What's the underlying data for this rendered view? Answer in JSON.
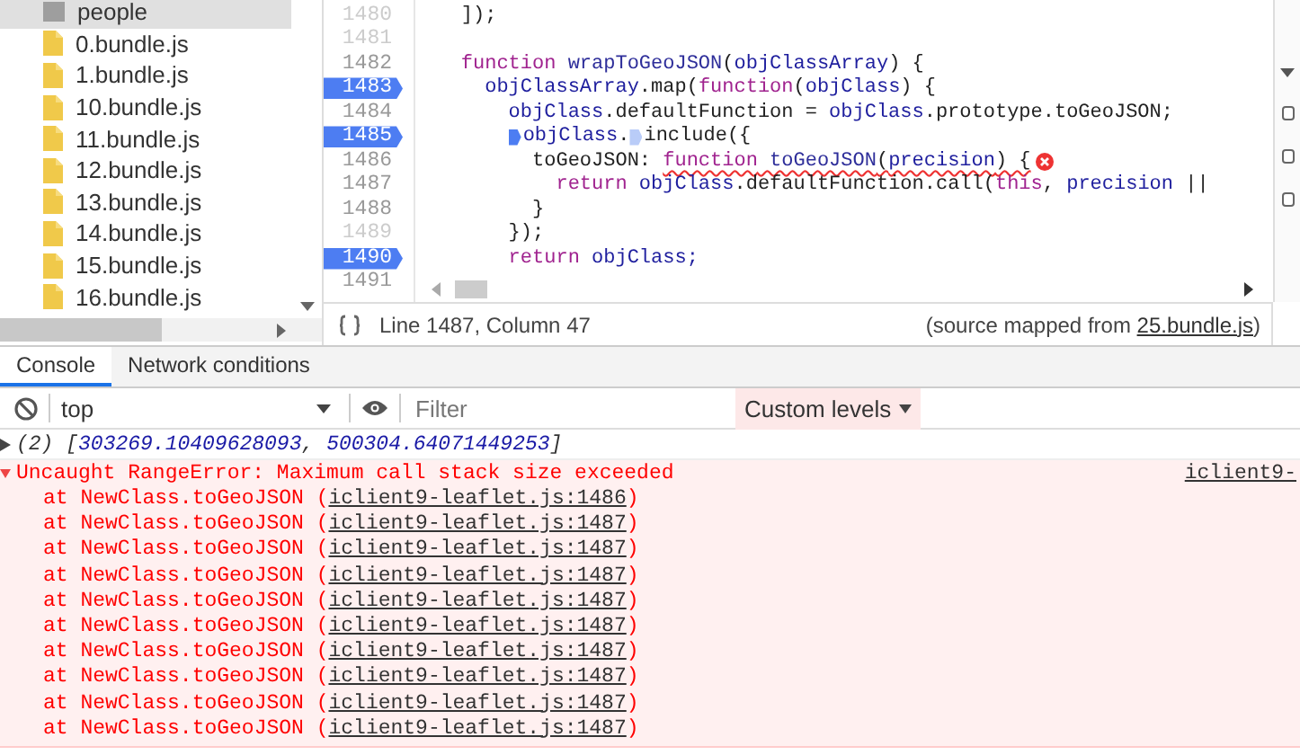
{
  "sidebar": {
    "items": [
      {
        "label": "people",
        "kind": "folder",
        "selected": true
      },
      {
        "label": "0.bundle.js",
        "kind": "file",
        "selected": false
      },
      {
        "label": "1.bundle.js",
        "kind": "file",
        "selected": false
      },
      {
        "label": "10.bundle.js",
        "kind": "file",
        "selected": false
      },
      {
        "label": "11.bundle.js",
        "kind": "file",
        "selected": false
      },
      {
        "label": "12.bundle.js",
        "kind": "file",
        "selected": false
      },
      {
        "label": "13.bundle.js",
        "kind": "file",
        "selected": false
      },
      {
        "label": "14.bundle.js",
        "kind": "file",
        "selected": false
      },
      {
        "label": "15.bundle.js",
        "kind": "file",
        "selected": false
      },
      {
        "label": "16.bundle.js",
        "kind": "file",
        "selected": false
      }
    ]
  },
  "editor": {
    "lines": [
      {
        "number": "1480",
        "breakpoint": false,
        "dim": true,
        "tokens": [
          {
            "text": "    ]);",
            "kind": "plain"
          }
        ]
      },
      {
        "number": "1481",
        "breakpoint": false,
        "dim": true
      },
      {
        "number": "1482",
        "breakpoint": false,
        "dim": false,
        "tokens": [
          {
            "text": "    function",
            "kind": "keyword"
          },
          {
            "text": " wrapToGeoJSON",
            "kind": "def"
          },
          {
            "text": "(",
            "kind": "plain"
          },
          {
            "text": "objClassArray",
            "kind": "name"
          },
          {
            "text": ") {",
            "kind": "plain"
          }
        ]
      },
      {
        "number": "1483",
        "breakpoint": true,
        "dim": false,
        "tokens": [
          {
            "text": "      objClassArray",
            "kind": "name"
          },
          {
            "text": ".map(",
            "kind": "plain"
          },
          {
            "text": "function",
            "kind": "keyword"
          },
          {
            "text": "(",
            "kind": "plain"
          },
          {
            "text": "objClass",
            "kind": "name"
          },
          {
            "text": ") {",
            "kind": "plain"
          }
        ]
      },
      {
        "number": "1484",
        "breakpoint": false,
        "dim": false,
        "tokens": [
          {
            "text": "        objClass",
            "kind": "name"
          },
          {
            "text": ".defaultFunction = ",
            "kind": "plain"
          },
          {
            "text": "objClass",
            "kind": "name"
          },
          {
            "text": ".prototype.toGeoJSON;",
            "kind": "plain"
          }
        ]
      },
      {
        "number": "1485",
        "breakpoint": true,
        "dim": false,
        "tokens": [
          {
            "text": "        objClass",
            "kind": "name",
            "marker": true,
            "active": true
          },
          {
            "text": ".",
            "kind": "plain"
          },
          {
            "text": "include({",
            "kind": "plain",
            "marker": true,
            "active": false
          }
        ]
      },
      {
        "number": "1486",
        "breakpoint": false,
        "dim": false,
        "error": true,
        "tokens": [
          {
            "text": "          toGeoJSON: ",
            "kind": "plain"
          },
          {
            "text": "function",
            "kind": "keyword",
            "squiggle": true
          },
          {
            "text": " toGeoJSON",
            "kind": "def",
            "squiggle": true
          },
          {
            "text": "(",
            "kind": "plain",
            "squiggle": true
          },
          {
            "text": "precision",
            "kind": "name",
            "squiggle": true
          },
          {
            "text": ") {",
            "kind": "plain",
            "squiggle": true
          }
        ]
      },
      {
        "number": "1487",
        "breakpoint": false,
        "dim": false,
        "tokens": [
          {
            "text": "            return",
            "kind": "keyword"
          },
          {
            "text": " objClass",
            "kind": "name"
          },
          {
            "text": ".defaultFunction.call(",
            "kind": "plain"
          },
          {
            "text": "this",
            "kind": "keyword"
          },
          {
            "text": ", ",
            "kind": "plain"
          },
          {
            "text": "precision",
            "kind": "name"
          },
          {
            "text": " ||",
            "kind": "plain"
          }
        ]
      },
      {
        "number": "1488",
        "breakpoint": false,
        "dim": false,
        "tokens": [
          {
            "text": "          }",
            "kind": "plain"
          }
        ]
      },
      {
        "number": "1489",
        "breakpoint": false,
        "dim": true,
        "tokens": [
          {
            "text": "        });",
            "kind": "plain"
          }
        ]
      },
      {
        "number": "1490",
        "breakpoint": true,
        "dim": false,
        "tokens": [
          {
            "text": "        return",
            "kind": "keyword"
          },
          {
            "text": " objClass;",
            "kind": "name"
          }
        ]
      },
      {
        "number": "1491",
        "breakpoint": false,
        "dim": false
      }
    ]
  },
  "status_bar": {
    "position": "Line 1487, Column 47",
    "source_before": "(source mapped from ",
    "source_link": "25.bundle.js",
    "source_after": ")"
  },
  "drawer": {
    "tabs": [
      {
        "label": "Console",
        "selected": true
      },
      {
        "label": "Network conditions",
        "selected": false
      }
    ],
    "toolbar": {
      "context": "top",
      "filter": {
        "placeholder": "Filter"
      },
      "levels": "Custom levels"
    },
    "messages": [
      {
        "kind": "log",
        "expanded": false,
        "tokens": [
          {
            "text": "(2) [",
            "kind": "plain"
          },
          {
            "text": "303269.10409628093",
            "kind": "number"
          },
          {
            "text": ", ",
            "kind": "plain"
          },
          {
            "text": "500304.64071449253",
            "kind": "number"
          },
          {
            "text": "]",
            "kind": "plain"
          }
        ]
      },
      {
        "kind": "error",
        "expanded": true,
        "message": "Uncaught RangeError: Maximum call stack size exceeded",
        "source": "iclient9-",
        "frames": [
          {
            "before": "at NewClass.toGeoJSON (",
            "link": "iclient9-leaflet.js:1486",
            "after": ")"
          },
          {
            "before": "at NewClass.toGeoJSON (",
            "link": "iclient9-leaflet.js:1487",
            "after": ")"
          },
          {
            "before": "at NewClass.toGeoJSON (",
            "link": "iclient9-leaflet.js:1487",
            "after": ")"
          },
          {
            "before": "at NewClass.toGeoJSON (",
            "link": "iclient9-leaflet.js:1487",
            "after": ")"
          },
          {
            "before": "at NewClass.toGeoJSON (",
            "link": "iclient9-leaflet.js:1487",
            "after": ")"
          },
          {
            "before": "at NewClass.toGeoJSON (",
            "link": "iclient9-leaflet.js:1487",
            "after": ")"
          },
          {
            "before": "at NewClass.toGeoJSON (",
            "link": "iclient9-leaflet.js:1487",
            "after": ")"
          },
          {
            "before": "at NewClass.toGeoJSON (",
            "link": "iclient9-leaflet.js:1487",
            "after": ")"
          },
          {
            "before": "at NewClass.toGeoJSON (",
            "link": "iclient9-leaflet.js:1487",
            "after": ")"
          },
          {
            "before": "at NewClass.toGeoJSON (",
            "link": "iclient9-leaflet.js:1487",
            "after": ")"
          }
        ]
      }
    ]
  }
}
